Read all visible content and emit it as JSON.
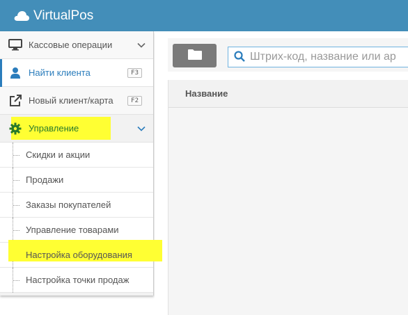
{
  "app": {
    "title": "VirtualPos"
  },
  "colors": {
    "topbar": "#438eb9",
    "accent": "#2b7dbc",
    "highlight": "#ffff33",
    "manage_icon": "#2a7a2a"
  },
  "sidebar": {
    "items": [
      {
        "label": "Кассовые операции",
        "icon": "monitor-icon",
        "has_chevron": true
      },
      {
        "label": "Найти клиента",
        "icon": "user-icon",
        "shortcut": "F3",
        "active": true
      },
      {
        "label": "Новый клиент/карта",
        "icon": "external-link-icon",
        "shortcut": "F2"
      },
      {
        "label": "Управление",
        "icon": "gear-icon",
        "has_chevron": true,
        "expanded": true
      }
    ],
    "submenu": [
      {
        "label": "Скидки и акции"
      },
      {
        "label": "Продажи"
      },
      {
        "label": "Заказы покупателей"
      },
      {
        "label": "Управление товарами"
      },
      {
        "label": "Настройка оборудования"
      },
      {
        "label": "Настройка точки продаж",
        "highlighted": true
      }
    ]
  },
  "toolbar": {
    "folder_icon": "folder-icon",
    "search": {
      "placeholder": "Штрих-код, название или ар",
      "icon": "search-icon"
    }
  },
  "grid": {
    "columns": [
      "Название"
    ]
  }
}
